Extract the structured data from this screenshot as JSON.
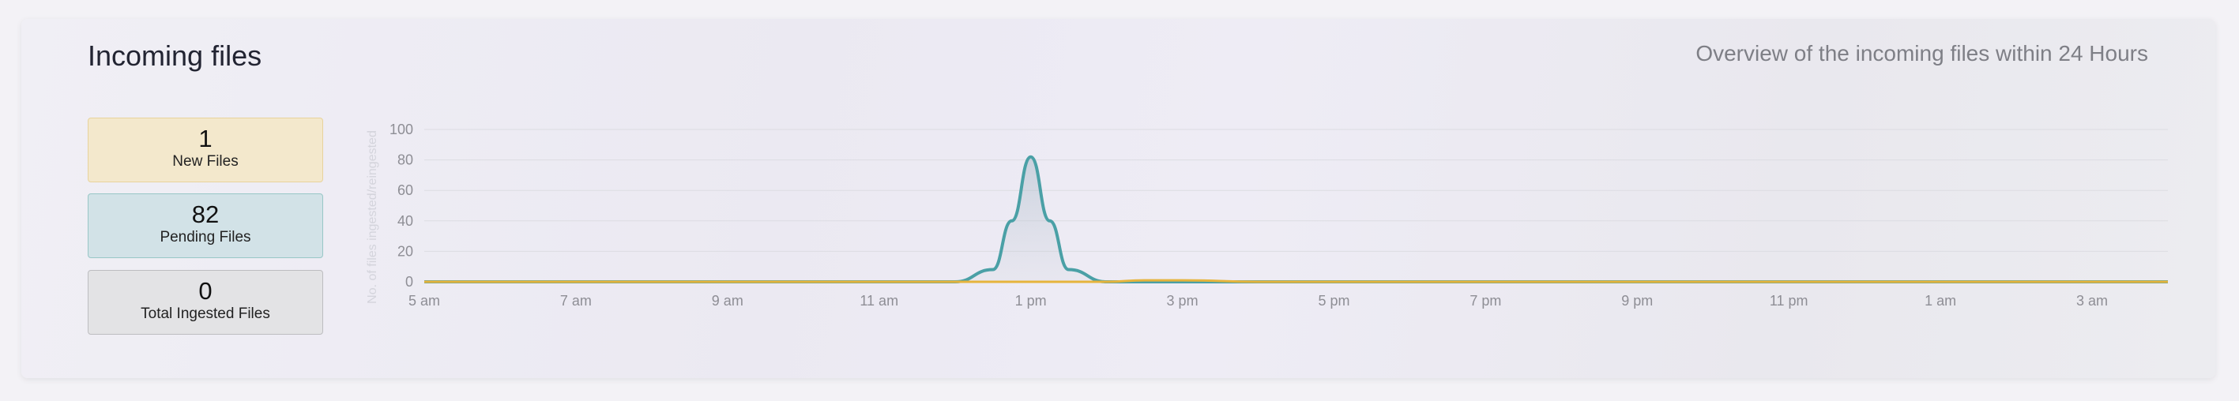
{
  "header": {
    "title": "Incoming files",
    "subtitle": "Overview of the incoming files within 24 Hours"
  },
  "stats": [
    {
      "value": "1",
      "label": "New Files"
    },
    {
      "value": "82",
      "label": "Pending Files"
    },
    {
      "value": "0",
      "label": "Total Ingested Files"
    }
  ],
  "colors": {
    "pending_series": "#4aa0a6",
    "ingested_series": "#e6b43c",
    "grid": "#dcdce2"
  },
  "chart_data": {
    "type": "area",
    "title": "",
    "xlabel": "",
    "ylabel": "No. of files ingested/reingested",
    "ylim": [
      0,
      100
    ],
    "yticks": [
      0,
      20,
      40,
      60,
      80,
      100
    ],
    "xlim": [
      5,
      28
    ],
    "x_tick_labels": [
      "5 am",
      "7 am",
      "9 am",
      "11 am",
      "1 pm",
      "3 pm",
      "5 pm",
      "7 pm",
      "9 pm",
      "11 pm",
      "1 am",
      "3 am"
    ],
    "grid": true,
    "series": [
      {
        "color": "#4aa0a6",
        "fill": true,
        "points": [
          [
            5,
            0
          ],
          [
            12,
            0
          ],
          [
            12.5,
            8
          ],
          [
            12.75,
            40
          ],
          [
            13,
            82
          ],
          [
            13.25,
            40
          ],
          [
            13.5,
            8
          ],
          [
            14,
            0
          ],
          [
            28,
            0
          ]
        ]
      },
      {
        "color": "#e6b43c",
        "fill": false,
        "points": [
          [
            5,
            0
          ],
          [
            14,
            0
          ],
          [
            14.5,
            1
          ],
          [
            15,
            1
          ],
          [
            16,
            0
          ],
          [
            28,
            0
          ]
        ]
      }
    ]
  }
}
